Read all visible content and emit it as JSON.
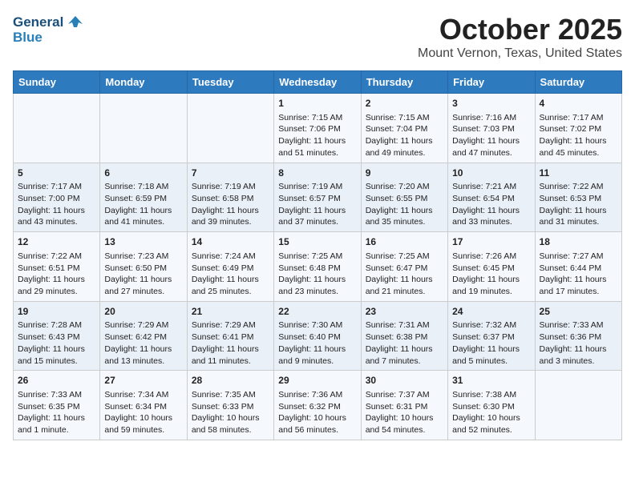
{
  "header": {
    "logo_general": "General",
    "logo_blue": "Blue",
    "title": "October 2025",
    "subtitle": "Mount Vernon, Texas, United States"
  },
  "days_of_week": [
    "Sunday",
    "Monday",
    "Tuesday",
    "Wednesday",
    "Thursday",
    "Friday",
    "Saturday"
  ],
  "weeks": [
    [
      {
        "day": "",
        "sunrise": "",
        "sunset": "",
        "daylight": ""
      },
      {
        "day": "",
        "sunrise": "",
        "sunset": "",
        "daylight": ""
      },
      {
        "day": "",
        "sunrise": "",
        "sunset": "",
        "daylight": ""
      },
      {
        "day": "1",
        "sunrise": "Sunrise: 7:15 AM",
        "sunset": "Sunset: 7:06 PM",
        "daylight": "Daylight: 11 hours and 51 minutes."
      },
      {
        "day": "2",
        "sunrise": "Sunrise: 7:15 AM",
        "sunset": "Sunset: 7:04 PM",
        "daylight": "Daylight: 11 hours and 49 minutes."
      },
      {
        "day": "3",
        "sunrise": "Sunrise: 7:16 AM",
        "sunset": "Sunset: 7:03 PM",
        "daylight": "Daylight: 11 hours and 47 minutes."
      },
      {
        "day": "4",
        "sunrise": "Sunrise: 7:17 AM",
        "sunset": "Sunset: 7:02 PM",
        "daylight": "Daylight: 11 hours and 45 minutes."
      }
    ],
    [
      {
        "day": "5",
        "sunrise": "Sunrise: 7:17 AM",
        "sunset": "Sunset: 7:00 PM",
        "daylight": "Daylight: 11 hours and 43 minutes."
      },
      {
        "day": "6",
        "sunrise": "Sunrise: 7:18 AM",
        "sunset": "Sunset: 6:59 PM",
        "daylight": "Daylight: 11 hours and 41 minutes."
      },
      {
        "day": "7",
        "sunrise": "Sunrise: 7:19 AM",
        "sunset": "Sunset: 6:58 PM",
        "daylight": "Daylight: 11 hours and 39 minutes."
      },
      {
        "day": "8",
        "sunrise": "Sunrise: 7:19 AM",
        "sunset": "Sunset: 6:57 PM",
        "daylight": "Daylight: 11 hours and 37 minutes."
      },
      {
        "day": "9",
        "sunrise": "Sunrise: 7:20 AM",
        "sunset": "Sunset: 6:55 PM",
        "daylight": "Daylight: 11 hours and 35 minutes."
      },
      {
        "day": "10",
        "sunrise": "Sunrise: 7:21 AM",
        "sunset": "Sunset: 6:54 PM",
        "daylight": "Daylight: 11 hours and 33 minutes."
      },
      {
        "day": "11",
        "sunrise": "Sunrise: 7:22 AM",
        "sunset": "Sunset: 6:53 PM",
        "daylight": "Daylight: 11 hours and 31 minutes."
      }
    ],
    [
      {
        "day": "12",
        "sunrise": "Sunrise: 7:22 AM",
        "sunset": "Sunset: 6:51 PM",
        "daylight": "Daylight: 11 hours and 29 minutes."
      },
      {
        "day": "13",
        "sunrise": "Sunrise: 7:23 AM",
        "sunset": "Sunset: 6:50 PM",
        "daylight": "Daylight: 11 hours and 27 minutes."
      },
      {
        "day": "14",
        "sunrise": "Sunrise: 7:24 AM",
        "sunset": "Sunset: 6:49 PM",
        "daylight": "Daylight: 11 hours and 25 minutes."
      },
      {
        "day": "15",
        "sunrise": "Sunrise: 7:25 AM",
        "sunset": "Sunset: 6:48 PM",
        "daylight": "Daylight: 11 hours and 23 minutes."
      },
      {
        "day": "16",
        "sunrise": "Sunrise: 7:25 AM",
        "sunset": "Sunset: 6:47 PM",
        "daylight": "Daylight: 11 hours and 21 minutes."
      },
      {
        "day": "17",
        "sunrise": "Sunrise: 7:26 AM",
        "sunset": "Sunset: 6:45 PM",
        "daylight": "Daylight: 11 hours and 19 minutes."
      },
      {
        "day": "18",
        "sunrise": "Sunrise: 7:27 AM",
        "sunset": "Sunset: 6:44 PM",
        "daylight": "Daylight: 11 hours and 17 minutes."
      }
    ],
    [
      {
        "day": "19",
        "sunrise": "Sunrise: 7:28 AM",
        "sunset": "Sunset: 6:43 PM",
        "daylight": "Daylight: 11 hours and 15 minutes."
      },
      {
        "day": "20",
        "sunrise": "Sunrise: 7:29 AM",
        "sunset": "Sunset: 6:42 PM",
        "daylight": "Daylight: 11 hours and 13 minutes."
      },
      {
        "day": "21",
        "sunrise": "Sunrise: 7:29 AM",
        "sunset": "Sunset: 6:41 PM",
        "daylight": "Daylight: 11 hours and 11 minutes."
      },
      {
        "day": "22",
        "sunrise": "Sunrise: 7:30 AM",
        "sunset": "Sunset: 6:40 PM",
        "daylight": "Daylight: 11 hours and 9 minutes."
      },
      {
        "day": "23",
        "sunrise": "Sunrise: 7:31 AM",
        "sunset": "Sunset: 6:38 PM",
        "daylight": "Daylight: 11 hours and 7 minutes."
      },
      {
        "day": "24",
        "sunrise": "Sunrise: 7:32 AM",
        "sunset": "Sunset: 6:37 PM",
        "daylight": "Daylight: 11 hours and 5 minutes."
      },
      {
        "day": "25",
        "sunrise": "Sunrise: 7:33 AM",
        "sunset": "Sunset: 6:36 PM",
        "daylight": "Daylight: 11 hours and 3 minutes."
      }
    ],
    [
      {
        "day": "26",
        "sunrise": "Sunrise: 7:33 AM",
        "sunset": "Sunset: 6:35 PM",
        "daylight": "Daylight: 11 hours and 1 minute."
      },
      {
        "day": "27",
        "sunrise": "Sunrise: 7:34 AM",
        "sunset": "Sunset: 6:34 PM",
        "daylight": "Daylight: 10 hours and 59 minutes."
      },
      {
        "day": "28",
        "sunrise": "Sunrise: 7:35 AM",
        "sunset": "Sunset: 6:33 PM",
        "daylight": "Daylight: 10 hours and 58 minutes."
      },
      {
        "day": "29",
        "sunrise": "Sunrise: 7:36 AM",
        "sunset": "Sunset: 6:32 PM",
        "daylight": "Daylight: 10 hours and 56 minutes."
      },
      {
        "day": "30",
        "sunrise": "Sunrise: 7:37 AM",
        "sunset": "Sunset: 6:31 PM",
        "daylight": "Daylight: 10 hours and 54 minutes."
      },
      {
        "day": "31",
        "sunrise": "Sunrise: 7:38 AM",
        "sunset": "Sunset: 6:30 PM",
        "daylight": "Daylight: 10 hours and 52 minutes."
      },
      {
        "day": "",
        "sunrise": "",
        "sunset": "",
        "daylight": ""
      }
    ]
  ]
}
